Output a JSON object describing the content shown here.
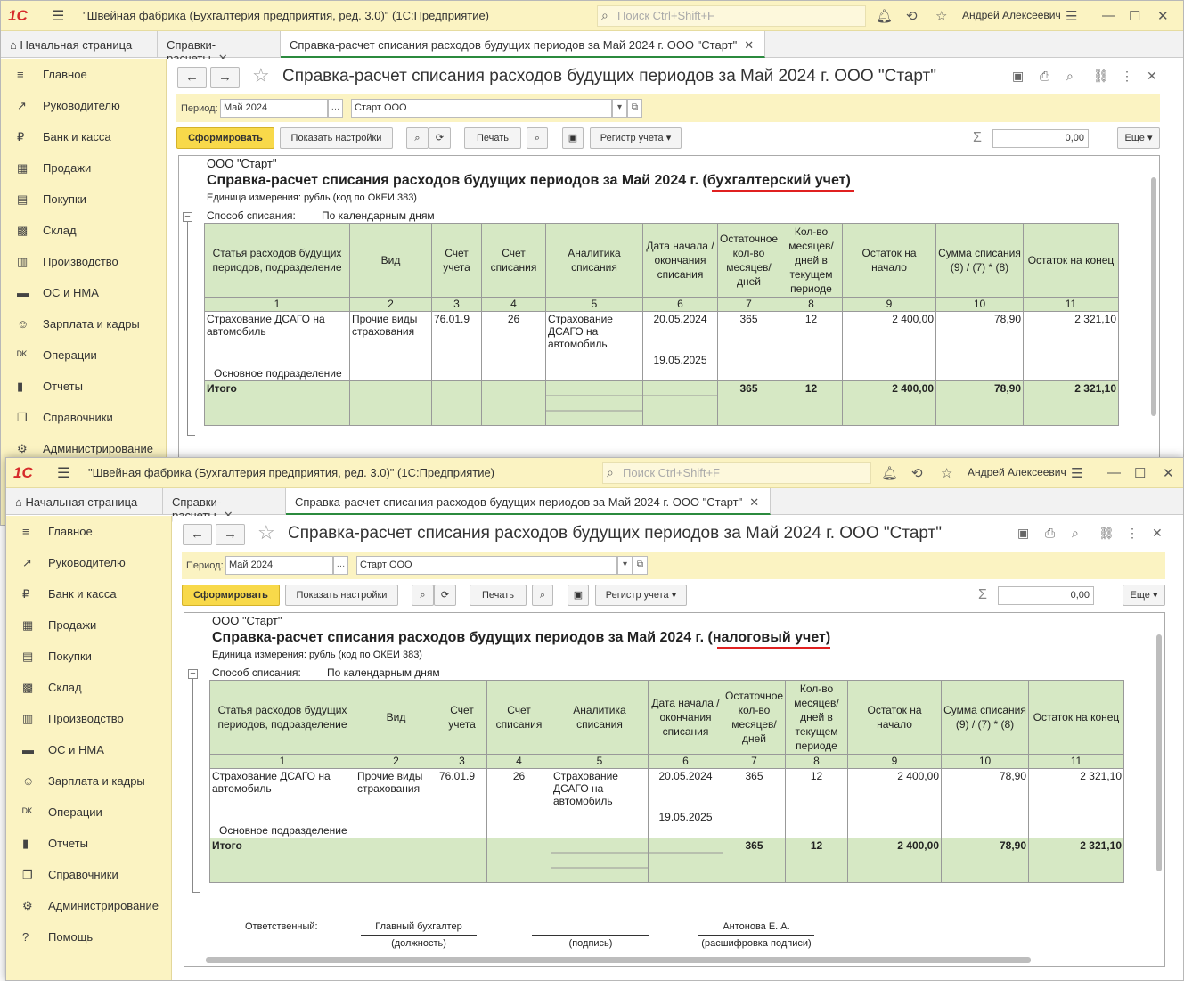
{
  "app": {
    "logo": "1С",
    "title": "\"Швейная фабрика (Бухгалтерия предприятия, ред. 3.0)\"  (1С:Предприятие)",
    "search_placeholder": "Поиск Ctrl+Shift+F",
    "user": "Андрей Алексеевич"
  },
  "tabs": {
    "home": "Начальная страница",
    "refs": "Справки-расчеты",
    "active": "Справка-расчет списания расходов будущих периодов за Май 2024 г. ООО \"Старт\""
  },
  "sidebar": {
    "items": [
      {
        "icon": "≡",
        "label": "Главное"
      },
      {
        "icon": "↗",
        "label": "Руководителю"
      },
      {
        "icon": "₽",
        "label": "Банк и касса"
      },
      {
        "icon": "▦",
        "label": "Продажи"
      },
      {
        "icon": "▤",
        "label": "Покупки"
      },
      {
        "icon": "▩",
        "label": "Склад"
      },
      {
        "icon": "▥",
        "label": "Производство"
      },
      {
        "icon": "▬",
        "label": "ОС и НМА"
      },
      {
        "icon": "☺",
        "label": "Зарплата и кадры"
      },
      {
        "icon": "ᴰᴷ",
        "label": "Операции"
      },
      {
        "icon": "▮",
        "label": "Отчеты"
      },
      {
        "icon": "❐",
        "label": "Справочники"
      },
      {
        "icon": "⚙",
        "label": "Администрирование"
      },
      {
        "icon": "?",
        "label": "Помощь"
      }
    ]
  },
  "form": {
    "title": "Справка-расчет списания расходов будущих периодов за Май 2024 г. ООО \"Старт\"",
    "period_label": "Период:",
    "period_value": "Май 2024",
    "org_value": "Старт ООО",
    "generate": "Сформировать",
    "show_settings": "Показать настройки",
    "print": "Печать",
    "register": "Регистр учета",
    "sum_value": "0,00",
    "more": "Еще"
  },
  "report": {
    "org": "ООО \"Старт\"",
    "title_base": "Справка-расчет списания расходов будущих периодов за Май 2024 г.",
    "title_accounting": "(бухгалтерский учет)",
    "title_tax": "(налоговый учет)",
    "unit": "Единица измерения: рубль (код по ОКЕИ 383)",
    "method_label": "Способ списания:",
    "method_value": "По календарным дням",
    "headers": [
      "Статья расходов будущих периодов, подразделение",
      "Вид",
      "Счет учета",
      "Счет списания",
      "Аналитика списания",
      "Дата начала / окончания списания",
      "Остаточное кол-во месяцев/ дней",
      "Кол-во месяцев/ дней в текущем периоде",
      "Остаток на начало",
      "Сумма списания (9) / (7) * (8)",
      "Остаток на конец"
    ],
    "numbers": [
      "1",
      "2",
      "3",
      "4",
      "5",
      "6",
      "7",
      "8",
      "9",
      "10",
      "11"
    ],
    "row": {
      "article": "Страхование ДСАГО на автомобиль",
      "subdivision": "Основное подразделение",
      "kind": "Прочие виды страхования",
      "account": "76.01.9",
      "writeoff_account": "26",
      "analytics": "Страхование ДСАГО на автомобиль",
      "date_start": "20.05.2024",
      "date_end": "19.05.2025",
      "remaining": "365",
      "current": "12",
      "start_balance": "2 400,00",
      "writeoff_sum": "78,90",
      "end_balance": "2 321,10"
    },
    "total": {
      "label": "Итого",
      "remaining": "365",
      "current": "12",
      "start_balance": "2 400,00",
      "writeoff_sum": "78,90",
      "end_balance": "2 321,10"
    },
    "signature": {
      "responsible": "Ответственный:",
      "position": "Главный бухгалтер",
      "position_caption": "(должность)",
      "sign_caption": "(подпись)",
      "name": "Антонова Е. А.",
      "name_caption": "(расшифровка подписи)"
    }
  }
}
